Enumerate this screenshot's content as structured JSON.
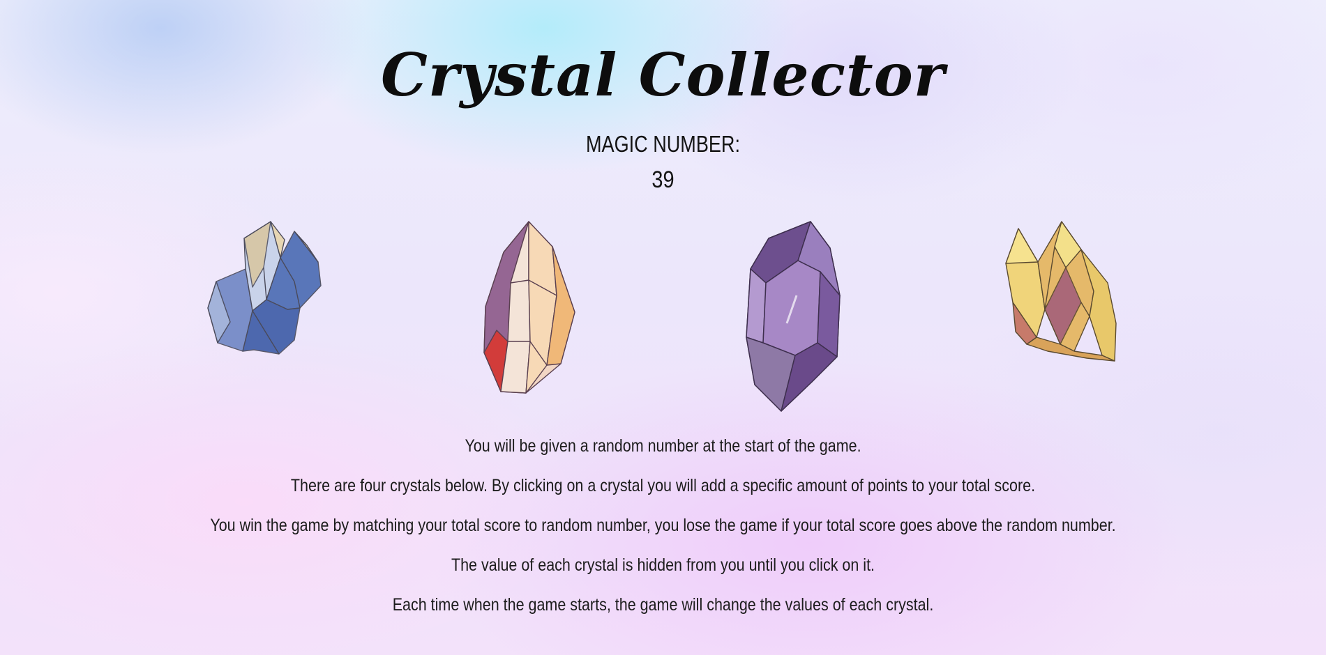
{
  "title": "Crystal Collector",
  "magic": {
    "label": "MAGIC NUMBER:",
    "value": "39"
  },
  "crystals": [
    {
      "name": "crystal-blue",
      "colors": [
        "#3f5fa6",
        "#d8c49a"
      ]
    },
    {
      "name": "crystal-peach",
      "colors": [
        "#c23b3b",
        "#f0c9a8",
        "#7d4f86"
      ]
    },
    {
      "name": "crystal-purple",
      "colors": [
        "#6f4f93",
        "#b9a3d0"
      ]
    },
    {
      "name": "crystal-yellow",
      "colors": [
        "#e7c54a",
        "#a5586c"
      ]
    }
  ],
  "instructions": [
    "You will be given a random number at the start of the game.",
    "There are four crystals below. By clicking on a crystal you will add a specific amount of points to your total score.",
    "You win the game by matching your total score to random number, you lose the game if your total score goes above the random number.",
    "The value of each crystal is hidden from you until you click on it.",
    "Each time when the game starts, the game will change the values of each crystal."
  ]
}
